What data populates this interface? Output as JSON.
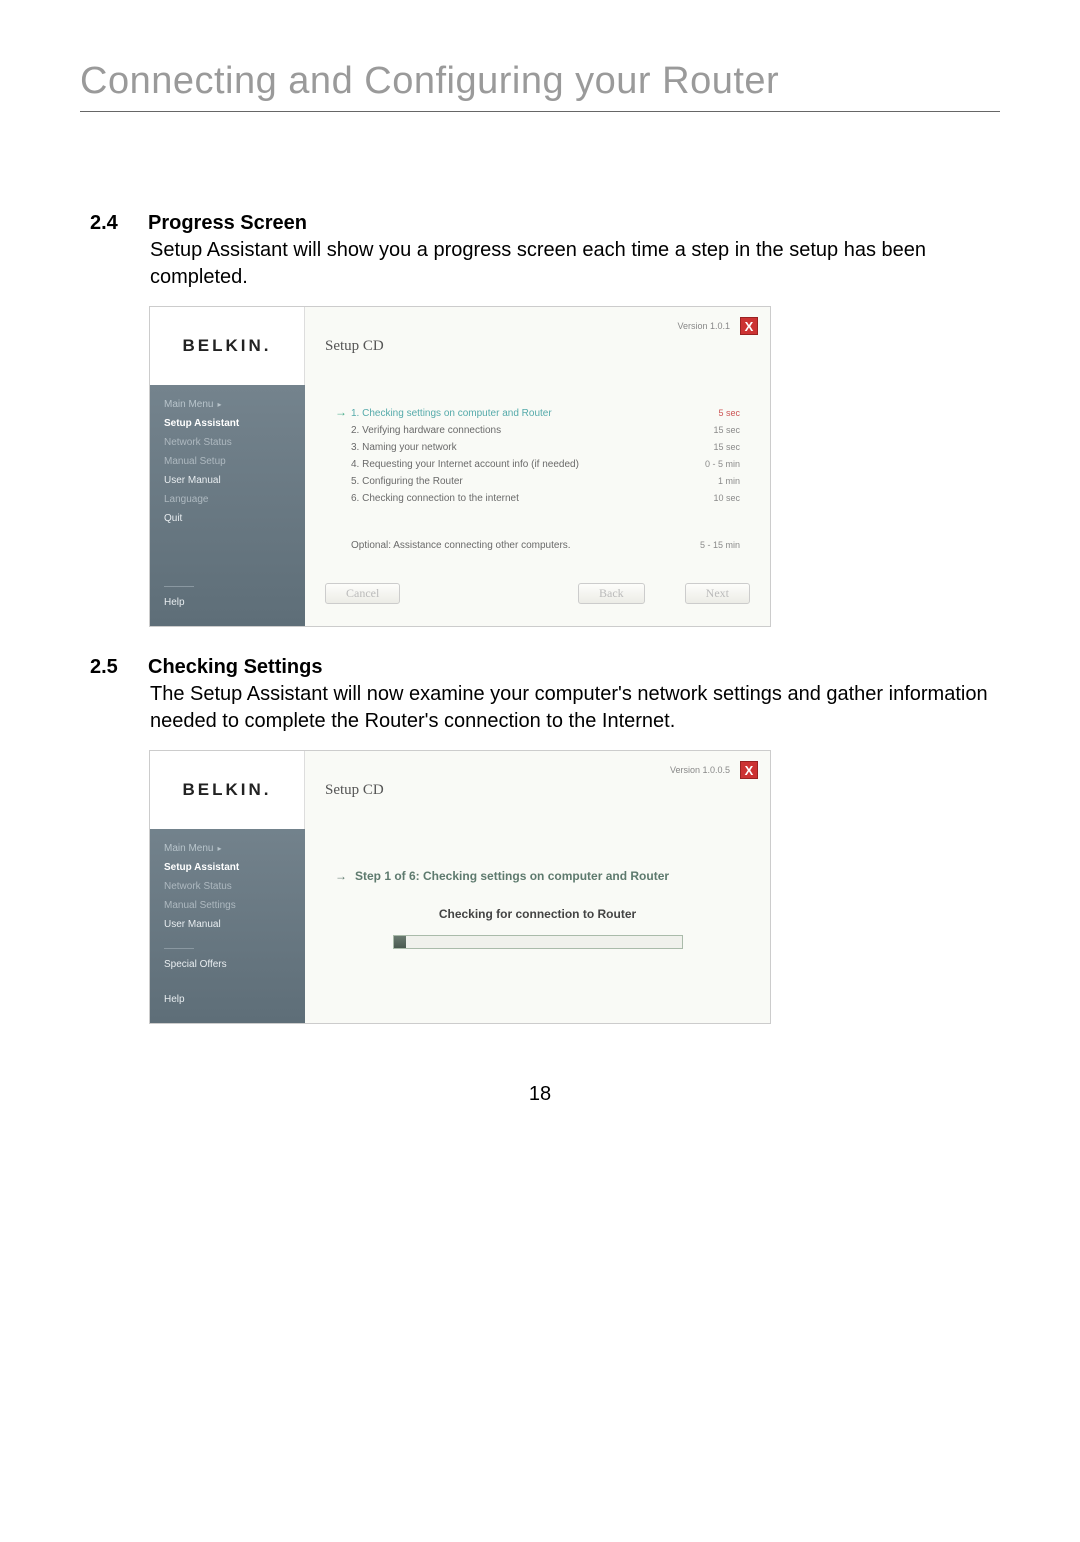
{
  "page": {
    "title": "Connecting and Configuring your Router",
    "number": "18"
  },
  "sections": [
    {
      "num": "2.4",
      "title": "Progress Screen",
      "body": "Setup Assistant will show you a progress screen each time a step in the setup has been completed."
    },
    {
      "num": "2.5",
      "title": "Checking Settings",
      "body": "The Setup Assistant will now examine your computer's network settings and gather information needed to complete the Router's connection to the Internet."
    }
  ],
  "screenshot1": {
    "logo": "BELKIN.",
    "appTitle": "Setup CD",
    "version": "Version 1.0.1",
    "close": "X",
    "sidebar": {
      "mainMenu": "Main Menu",
      "items": [
        {
          "label": "Setup Assistant",
          "active": true
        },
        {
          "label": "Network Status"
        },
        {
          "label": "Manual Setup"
        },
        {
          "label": "User Manual",
          "bright": true
        },
        {
          "label": "Language"
        },
        {
          "label": "Quit",
          "bright": true
        }
      ],
      "help": "Help"
    },
    "steps": [
      {
        "text": "1. Checking settings on computer and Router",
        "time": "5 sec",
        "current": true
      },
      {
        "text": "2. Verifying hardware connections",
        "time": "15 sec"
      },
      {
        "text": "3. Naming your network",
        "time": "15 sec"
      },
      {
        "text": "4. Requesting your Internet account info (if needed)",
        "time": "0 - 5 min"
      },
      {
        "text": "5. Configuring the Router",
        "time": "1 min"
      },
      {
        "text": "6. Checking connection to the internet",
        "time": "10 sec"
      }
    ],
    "optional": {
      "text": "Optional: Assistance connecting other computers.",
      "time": "5 - 15 min"
    },
    "buttons": {
      "cancel": "Cancel",
      "back": "Back",
      "next": "Next"
    }
  },
  "screenshot2": {
    "logo": "BELKIN.",
    "appTitle": "Setup CD",
    "version": "Version 1.0.0.5",
    "close": "X",
    "sidebar": {
      "mainMenu": "Main Menu",
      "items": [
        {
          "label": "Setup Assistant",
          "active": true
        },
        {
          "label": "Network Status"
        },
        {
          "label": "Manual Settings"
        },
        {
          "label": "User Manual",
          "bright": true
        }
      ],
      "specialOffers": "Special Offers",
      "help": "Help"
    },
    "stepHeader": "Step 1 of 6: Checking settings on computer and Router",
    "status": "Checking for connection to Router"
  }
}
